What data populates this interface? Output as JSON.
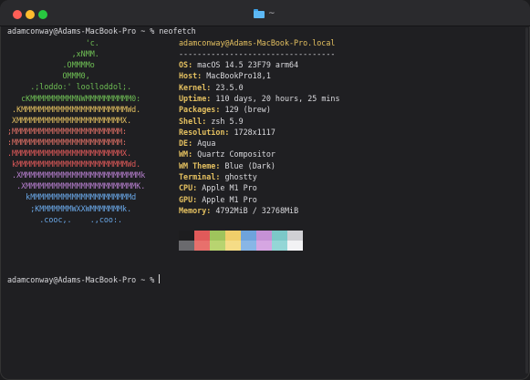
{
  "window": {
    "title": "~"
  },
  "terminal": {
    "command_prompt": "adamconway@Adams-MacBook-Pro ~ % neofetch",
    "final_prompt": "adamconway@Adams-MacBook-Pro ~ % ",
    "ascii_art": [
      {
        "text": "                 'c.",
        "color": "#6fbf55"
      },
      {
        "text": "              ,xNMM.",
        "color": "#6fbf55"
      },
      {
        "text": "            .OMMMMo",
        "color": "#6fbf55"
      },
      {
        "text": "            OMMM0,",
        "color": "#6fbf55"
      },
      {
        "text": "     .;loddo:' loolloddol;.",
        "color": "#6fbf55"
      },
      {
        "text": "   cKMMMMMMMMMMNWMMMMMMMMMM0:",
        "color": "#6fbf55"
      },
      {
        "text": " .KMMMMMMMMMMMMMMMMMMMMMMMWd.",
        "color": "#e4c060"
      },
      {
        "text": " XMMMMMMMMMMMMMMMMMMMMMMMX.",
        "color": "#e4c060"
      },
      {
        "text": ";MMMMMMMMMMMMMMMMMMMMMMMM:",
        "color": "#e07066"
      },
      {
        "text": ":MMMMMMMMMMMMMMMMMMMMMMMM:",
        "color": "#e07066"
      },
      {
        "text": ".MMMMMMMMMMMMMMMMMMMMMMMMX.",
        "color": "#e05a5a"
      },
      {
        "text": " kMMMMMMMMMMMMMMMMMMMMMMMMWd.",
        "color": "#e05a5a"
      },
      {
        "text": " .XMMMMMMMMMMMMMMMMMMMMMMMMMMk",
        "color": "#b880d0"
      },
      {
        "text": "  .XMMMMMMMMMMMMMMMMMMMMMMMMK.",
        "color": "#b880d0"
      },
      {
        "text": "    kMMMMMMMMMMMMMMMMMMMMMMd",
        "color": "#6aa8e8"
      },
      {
        "text": "     ;KMMMMMMMWXXWMMMMMMMk.",
        "color": "#6aa8e8"
      },
      {
        "text": "       .cooc,.    .,coo:.",
        "color": "#6aa8e8"
      }
    ],
    "info_header": "adamconway@Adams-MacBook-Pro.local",
    "info_separator": "----------------------------------",
    "info": [
      {
        "key": "OS",
        "value": "macOS 14.5 23F79 arm64"
      },
      {
        "key": "Host",
        "value": "MacBookPro18,1"
      },
      {
        "key": "Kernel",
        "value": "23.5.0"
      },
      {
        "key": "Uptime",
        "value": "110 days, 20 hours, 25 mins"
      },
      {
        "key": "Packages",
        "value": "129 (brew)"
      },
      {
        "key": "Shell",
        "value": "zsh 5.9"
      },
      {
        "key": "Resolution",
        "value": "1728x1117"
      },
      {
        "key": "DE",
        "value": "Aqua"
      },
      {
        "key": "WM",
        "value": "Quartz Compositor"
      },
      {
        "key": "WM Theme",
        "value": "Blue (Dark)"
      },
      {
        "key": "Terminal",
        "value": "ghostty"
      },
      {
        "key": "CPU",
        "value": "Apple M1 Pro"
      },
      {
        "key": "GPU",
        "value": "Apple M1 Pro"
      },
      {
        "key": "Memory",
        "value": "4792MiB / 32768MiB"
      }
    ],
    "palette_top": [
      "#1d1d1f",
      "#e05a5a",
      "#9fc45c",
      "#f0ce6a",
      "#6ea3dc",
      "#c591d6",
      "#7cc8c8",
      "#d0d0d4"
    ],
    "palette_bottom": [
      "#6a6a6e",
      "#e8706c",
      "#b8d470",
      "#f5dc86",
      "#88b6e6",
      "#d6a6e2",
      "#94d6d6",
      "#f2f2f4"
    ]
  }
}
